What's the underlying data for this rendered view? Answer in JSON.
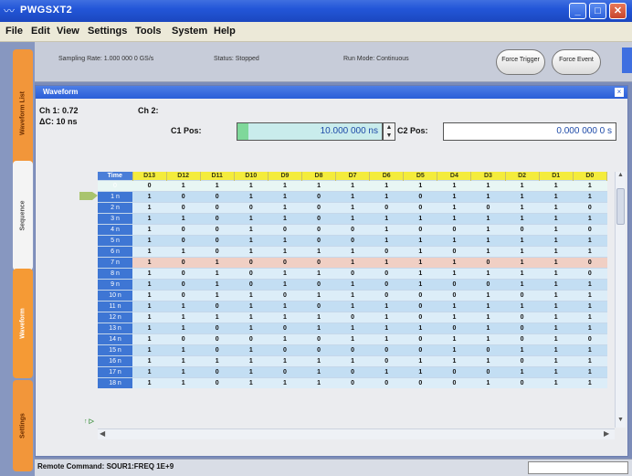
{
  "window": {
    "title": "PWGSXT2"
  },
  "menu": [
    "File",
    "Edit",
    "View",
    "Settings",
    "Tools",
    "System",
    "Help"
  ],
  "status": {
    "sampling": "Sampling Rate: 1.000 000 0 GS/s",
    "status": "Status: Stopped",
    "run_mode": "Run Mode: Continuous",
    "trigger_btn": "Force Trigger",
    "event_btn": "Force Event"
  },
  "sidebar_tabs": [
    "Waveform List",
    "Sequence",
    "Waveform",
    "Settings"
  ],
  "panel": {
    "title": "Waveform",
    "ch1": "Ch 1: 0.72",
    "delta": "ΔC: 10 ns",
    "ch2": "Ch 2:",
    "c1_label": "C1 Pos:",
    "c1_value": "10.000 000 ns",
    "c2_label": "C2 Pos:",
    "c2_value": "0.000 000 0 s"
  },
  "table": {
    "time_header": "Time",
    "bit_headers": [
      "D13",
      "D12",
      "D11",
      "D10",
      "D9",
      "D8",
      "D7",
      "D6",
      "D5",
      "D4",
      "D3",
      "D2",
      "D1",
      "D0"
    ],
    "rows": [
      {
        "idx": "0",
        "bits": [
          "0",
          "1",
          "1",
          "1",
          "1",
          "1",
          "1",
          "1",
          "1",
          "1",
          "1",
          "1",
          "1",
          "1"
        ]
      },
      {
        "idx": "1 n",
        "bits": [
          "1",
          "0",
          "0",
          "1",
          "1",
          "0",
          "1",
          "1",
          "0",
          "1",
          "1",
          "1",
          "1",
          "1"
        ]
      },
      {
        "idx": "2 n",
        "bits": [
          "1",
          "0",
          "0",
          "0",
          "1",
          "0",
          "1",
          "0",
          "0",
          "1",
          "0",
          "1",
          "1",
          "0"
        ]
      },
      {
        "idx": "3 n",
        "bits": [
          "1",
          "1",
          "0",
          "1",
          "1",
          "0",
          "1",
          "1",
          "1",
          "1",
          "1",
          "1",
          "1",
          "1"
        ]
      },
      {
        "idx": "4 n",
        "bits": [
          "1",
          "0",
          "0",
          "1",
          "0",
          "0",
          "0",
          "1",
          "0",
          "0",
          "1",
          "0",
          "1",
          "0"
        ]
      },
      {
        "idx": "5 n",
        "bits": [
          "1",
          "0",
          "0",
          "1",
          "1",
          "0",
          "0",
          "1",
          "1",
          "1",
          "1",
          "1",
          "1",
          "1"
        ]
      },
      {
        "idx": "6 n",
        "bits": [
          "1",
          "1",
          "0",
          "1",
          "1",
          "1",
          "1",
          "0",
          "1",
          "0",
          "1",
          "1",
          "1",
          "1"
        ]
      },
      {
        "idx": "7 n",
        "bits": [
          "1",
          "0",
          "1",
          "0",
          "0",
          "0",
          "1",
          "1",
          "1",
          "1",
          "0",
          "1",
          "1",
          "0"
        ]
      },
      {
        "idx": "8 n",
        "bits": [
          "1",
          "0",
          "1",
          "0",
          "1",
          "1",
          "0",
          "0",
          "1",
          "1",
          "1",
          "1",
          "1",
          "0"
        ]
      },
      {
        "idx": "9 n",
        "bits": [
          "1",
          "0",
          "1",
          "0",
          "1",
          "0",
          "1",
          "0",
          "1",
          "0",
          "0",
          "1",
          "1",
          "1"
        ]
      },
      {
        "idx": "10 n",
        "bits": [
          "1",
          "0",
          "1",
          "1",
          "0",
          "1",
          "1",
          "0",
          "0",
          "0",
          "1",
          "0",
          "1",
          "1"
        ]
      },
      {
        "idx": "11 n",
        "bits": [
          "1",
          "1",
          "0",
          "1",
          "1",
          "0",
          "1",
          "1",
          "0",
          "1",
          "1",
          "1",
          "1",
          "1"
        ]
      },
      {
        "idx": "12 n",
        "bits": [
          "1",
          "1",
          "1",
          "1",
          "1",
          "1",
          "0",
          "1",
          "0",
          "1",
          "1",
          "0",
          "1",
          "1"
        ]
      },
      {
        "idx": "13 n",
        "bits": [
          "1",
          "1",
          "0",
          "1",
          "0",
          "1",
          "1",
          "1",
          "1",
          "0",
          "1",
          "0",
          "1",
          "1"
        ]
      },
      {
        "idx": "14 n",
        "bits": [
          "1",
          "0",
          "0",
          "0",
          "1",
          "0",
          "1",
          "1",
          "0",
          "1",
          "1",
          "0",
          "1",
          "0"
        ]
      },
      {
        "idx": "15 n",
        "bits": [
          "1",
          "1",
          "0",
          "1",
          "0",
          "0",
          "0",
          "0",
          "0",
          "1",
          "0",
          "1",
          "1",
          "1"
        ]
      },
      {
        "idx": "16 n",
        "bits": [
          "1",
          "1",
          "1",
          "1",
          "1",
          "1",
          "1",
          "0",
          "1",
          "1",
          "1",
          "0",
          "1",
          "1"
        ]
      },
      {
        "idx": "17 n",
        "bits": [
          "1",
          "1",
          "0",
          "1",
          "0",
          "1",
          "0",
          "1",
          "1",
          "0",
          "0",
          "1",
          "1",
          "1"
        ]
      },
      {
        "idx": "18 n",
        "bits": [
          "1",
          "1",
          "0",
          "1",
          "1",
          "1",
          "0",
          "0",
          "0",
          "0",
          "1",
          "0",
          "1",
          "1"
        ]
      }
    ]
  },
  "bottom": {
    "command": "Remote Command: SOUR1:FREQ 1E+9"
  }
}
